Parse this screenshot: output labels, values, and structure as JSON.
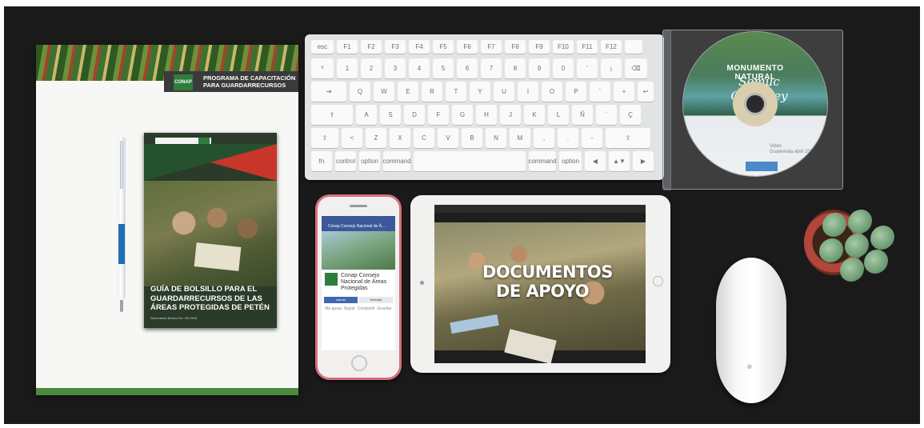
{
  "notepad": {
    "logo_text": "CONAP",
    "header_line1": "PROGRAMA DE CAPACITACIÓN",
    "header_line2": "PARA GUARDARRECURSOS"
  },
  "booklet": {
    "title_line1": "GUÍA DE BOLSILLO PARA EL",
    "title_line2": "GUARDARRECURSOS DE LAS",
    "title_line3": "ÁREAS PROTEGIDAS DE PETÉN",
    "footnote": "Documento técnico No. 0/4 2016"
  },
  "keyboard": {
    "fn_row": [
      "esc",
      "F1",
      "F2",
      "F3",
      "F4",
      "F5",
      "F6",
      "F7",
      "F8",
      "F9",
      "F10",
      "F11",
      "F12",
      ""
    ],
    "num_row": [
      "º",
      "1",
      "2",
      "3",
      "4",
      "5",
      "6",
      "7",
      "8",
      "9",
      "0",
      "'",
      "¡",
      "⌫"
    ],
    "top_row": [
      "⇥",
      "Q",
      "W",
      "E",
      "R",
      "T",
      "Y",
      "U",
      "I",
      "O",
      "P",
      "`",
      "+",
      "↩"
    ],
    "home_row": [
      "⇪",
      "A",
      "S",
      "D",
      "F",
      "G",
      "H",
      "J",
      "K",
      "L",
      "Ñ",
      "´",
      "Ç"
    ],
    "bottom_row": [
      "⇧",
      "<",
      "Z",
      "X",
      "C",
      "V",
      "B",
      "N",
      "M",
      ",",
      ".",
      "-",
      "⇧"
    ],
    "mod_row": [
      "fn",
      "control",
      "option",
      "command",
      "",
      "command",
      "option",
      "◀",
      "▲▼",
      "▶"
    ]
  },
  "cd": {
    "title": "MONUMENTO NATURAL",
    "subtitle": "Semuc Champey",
    "video_line1": "Video",
    "video_line2": "Guatemala abril 2017"
  },
  "phone": {
    "fb_bar": "Conap Consejo Nacional de Á...",
    "page_name": "Conap Consejo Nacional de Áreas Protegidas",
    "like_label": "Llamar",
    "message_label": "Mensaje",
    "actions": [
      "Me gusta",
      "Seguir",
      "Compartir",
      "Guardar"
    ]
  },
  "tablet": {
    "headline_line1": "DOCUMENTOS",
    "headline_line2": "DE APOYO"
  },
  "colors": {
    "background": "#1b1a1b",
    "conap_green": "#2f7d3c",
    "facebook_blue": "#3b5998",
    "booklet_red": "#c8362a",
    "phone_case": "#d76f7b"
  }
}
